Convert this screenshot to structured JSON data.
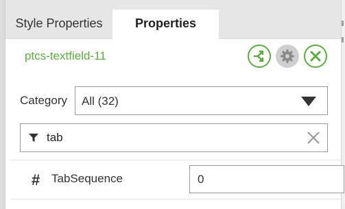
{
  "tabs": [
    {
      "label": "Style Properties",
      "active": false
    },
    {
      "label": "Properties",
      "active": true
    }
  ],
  "widget": {
    "name": "ptcs-textfield-11",
    "actions": [
      {
        "icon": "connector-icon",
        "style": "green"
      },
      {
        "icon": "gear-icon",
        "style": "gray"
      },
      {
        "icon": "close-icon",
        "style": "green"
      }
    ]
  },
  "category": {
    "label": "Category",
    "value": "All (32)"
  },
  "filter": {
    "value": "tab"
  },
  "properties": [
    {
      "type_icon": "hash-icon",
      "type_symbol": "#",
      "name": "TabSequence",
      "value": "0"
    }
  ],
  "colors": {
    "accent_green": "#5aad3c",
    "tab_strip": "#e6e6e6"
  }
}
